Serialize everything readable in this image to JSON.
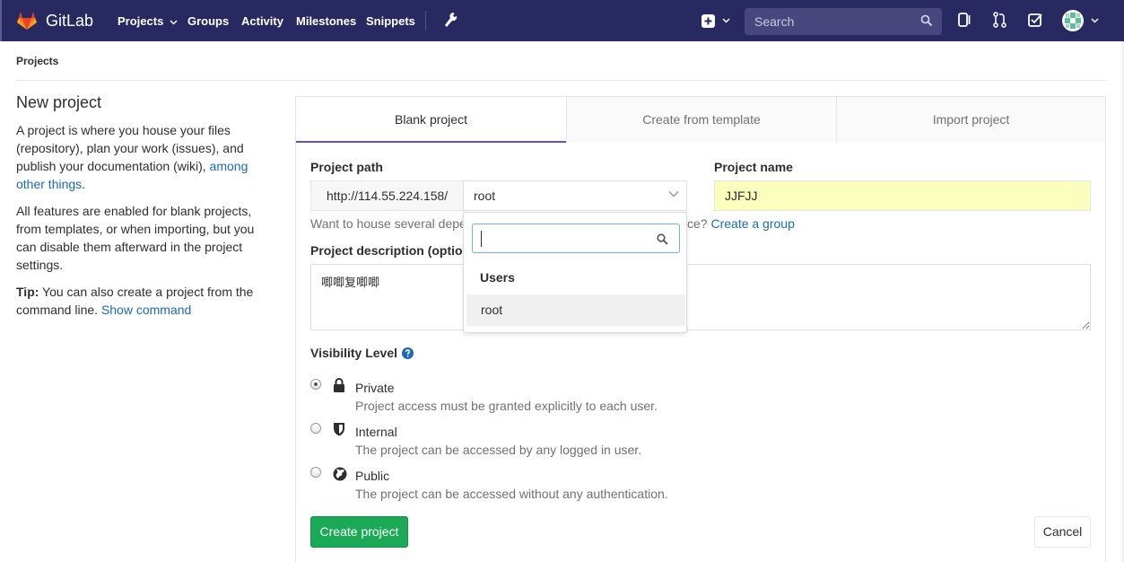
{
  "navbar": {
    "brand": "GitLab",
    "links": [
      "Projects",
      "Groups",
      "Activity",
      "Milestones",
      "Snippets"
    ],
    "search_placeholder": "Search"
  },
  "breadcrumb": "Projects",
  "sidebar": {
    "title": "New project",
    "para1": "A project is where you house your files (repository), plan your work (issues), and publish your documentation (wiki),",
    "para1_link": "among other things",
    "para1_end": ".",
    "para2": "All features are enabled for blank projects, from templates, or when importing, but you can disable them afterward in the project settings.",
    "tip_label": "Tip:",
    "tip_text": "You can also create a project from the command line.",
    "tip_link": "Show command"
  },
  "tabs": [
    "Blank project",
    "Create from template",
    "Import project"
  ],
  "form": {
    "path_label": "Project path",
    "url_prefix": "http://114.55.224.158/",
    "namespace": "root",
    "name_label": "Project name",
    "name_value": "JJFJJ",
    "help_text": "Want to house several depe",
    "help_text_end": "ce?",
    "help_link": "Create a group",
    "desc_label": "Project description (option",
    "desc_value": "唧唧复唧唧",
    "visibility_label": "Visibility Level",
    "visibility": [
      {
        "title": "Private",
        "desc": "Project access must be granted explicitly to each user.",
        "checked": true
      },
      {
        "title": "Internal",
        "desc": "The project can be accessed by any logged in user.",
        "checked": false
      },
      {
        "title": "Public",
        "desc": "The project can be accessed without any authentication.",
        "checked": false
      }
    ],
    "create_label": "Create project",
    "cancel_label": "Cancel"
  },
  "dropdown": {
    "header": "Users",
    "item": "root"
  },
  "colors": {
    "navbar": "#292961",
    "accent": "#1b69b6",
    "create_button": "#1aaa55",
    "tab_underline": "#6b4fbb",
    "autofill": "#faffbd"
  }
}
